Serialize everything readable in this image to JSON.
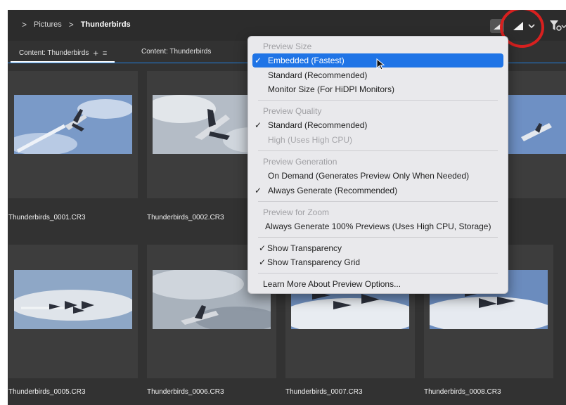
{
  "breadcrumb": {
    "root_chevron": ">",
    "sep": ">",
    "items": [
      "Pictures",
      "Thunderbirds"
    ]
  },
  "tabs": [
    {
      "label": "Content: Thunderbirds",
      "plus": "+",
      "menu": "≡"
    },
    {
      "label": "Content: Thunderbirds"
    }
  ],
  "files": [
    "Thunderbirds_0001.CR3",
    "Thunderbirds_0002.CR3",
    "Thunderbirds_0005.CR3",
    "Thunderbirds_0006.CR3",
    "Thunderbirds_0007.CR3",
    "Thunderbirds_0008.CR3"
  ],
  "menu": {
    "preview_size": {
      "header": "Preview Size",
      "items": [
        "Embedded (Fastest)",
        "Standard (Recommended)",
        "Monitor Size (For HiDPI Monitors)"
      ],
      "checked": "Embedded (Fastest)"
    },
    "preview_quality": {
      "header": "Preview Quality",
      "items": [
        "Standard (Recommended)",
        "High (Uses High CPU)"
      ],
      "checked": "Standard (Recommended)",
      "disabled": "High (Uses High CPU)"
    },
    "preview_generation": {
      "header": "Preview Generation",
      "items": [
        "On Demand (Generates Preview Only When Needed)",
        "Always Generate (Recommended)"
      ],
      "checked": "Always Generate (Recommended)"
    },
    "preview_zoom": {
      "header": "Preview for Zoom",
      "items": [
        "Always Generate 100% Previews (Uses High CPU, Storage)"
      ]
    },
    "transparency": [
      "Show Transparency",
      "Show Transparency Grid"
    ],
    "learn_more": "Learn More About Preview Options...",
    "check_glyph": "✓"
  },
  "colors": {
    "accent": "#1f74e6",
    "ring": "#d8201f",
    "tab_line": "#2080e0"
  },
  "icons": [
    "chevron-right-icon",
    "preview-quality-icon",
    "chevron-down-icon",
    "filter-icon",
    "pointer-cursor-icon"
  ]
}
